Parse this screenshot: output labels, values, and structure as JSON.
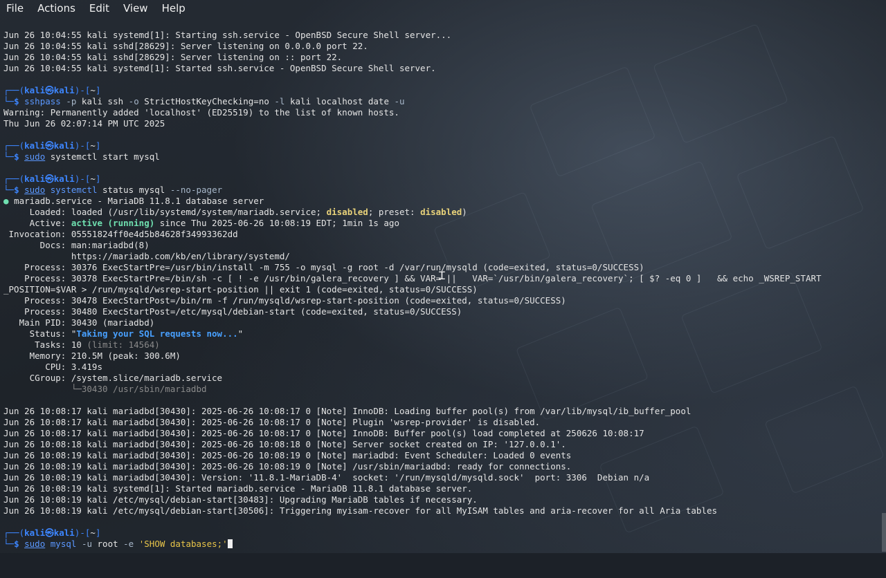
{
  "menu": [
    "File",
    "Actions",
    "Edit",
    "View",
    "Help"
  ],
  "prompt": {
    "user": "kali",
    "at": "㉿",
    "host": "kali",
    "dir": "~"
  },
  "lines": {
    "l1": "Jun 26 10:04:55 kali systemd[1]: Starting ssh.service - OpenBSD Secure Shell server...",
    "l2": "Jun 26 10:04:55 kali sshd[28629]: Server listening on 0.0.0.0 port 22.",
    "l3": "Jun 26 10:04:55 kali sshd[28629]: Server listening on :: port 22.",
    "l4": "Jun 26 10:04:55 kali systemd[1]: Started ssh.service - OpenBSD Secure Shell server.",
    "warn": "Warning: Permanently added 'localhost' (ED25519) to the list of known hosts.",
    "date": "Thu Jun 26 02:07:14 PM UTC 2025",
    "svc_head": "mariadb.service - MariaDB 11.8.1 database server",
    "loaded_a": "     Loaded: loaded (/usr/lib/systemd/system/mariadb.service; ",
    "loaded_b": "disabled",
    "loaded_c": "; preset: ",
    "loaded_d": "disabled",
    "loaded_e": ")",
    "active_a": "     Active: ",
    "active_b": "active (running)",
    "active_c": " since Thu 2025-06-26 10:08:19 EDT; 1min 1s ago",
    "invocation": " Invocation: 05551824ff0e4d5b84628f34993362dd",
    "docs1": "       Docs: man:mariadbd(8)",
    "docs2": "             https://mariadb.com/kb/en/library/systemd/",
    "proc1": "    Process: 30376 ExecStartPre=/usr/bin/install -m 755 -o mysql -g root -d /var/run/mysqld (code=exited, status=0/SUCCESS)",
    "proc2": "    Process: 30378 ExecStartPre=/bin/sh -c [ ! -e /usr/bin/galera_recovery ] && VAR= ||   VAR=`/usr/bin/galera_recovery`; [ $? -eq 0 ]   && echo _WSREP_START",
    "proc2b": "_POSITION=$VAR > /run/mysqld/wsrep-start-position || exit 1 (code=exited, status=0/SUCCESS)",
    "proc3": "    Process: 30478 ExecStartPost=/bin/rm -f /run/mysqld/wsrep-start-position (code=exited, status=0/SUCCESS)",
    "proc4": "    Process: 30480 ExecStartPost=/etc/mysql/debian-start (code=exited, status=0/SUCCESS)",
    "mainpid": "   Main PID: 30430 (mariadbd)",
    "status_a": "     Status: \"",
    "status_b": "Taking your SQL requests now...",
    "status_c": "\"",
    "tasks_a": "      Tasks: 10 ",
    "tasks_b": "(limit: 14564)",
    "memory": "     Memory: 210.5M (peak: 300.6M)",
    "cpu": "        CPU: 3.419s",
    "cgroup": "     CGroup: /system.slice/mariadb.service",
    "cgroup_child": "             └─30430 /usr/sbin/mariadbd",
    "j1": "Jun 26 10:08:17 kali mariadbd[30430]: 2025-06-26 10:08:17 0 [Note] InnoDB: Loading buffer pool(s) from /var/lib/mysql/ib_buffer_pool",
    "j2": "Jun 26 10:08:17 kali mariadbd[30430]: 2025-06-26 10:08:17 0 [Note] Plugin 'wsrep-provider' is disabled.",
    "j3": "Jun 26 10:08:17 kali mariadbd[30430]: 2025-06-26 10:08:17 0 [Note] InnoDB: Buffer pool(s) load completed at 250626 10:08:17",
    "j4": "Jun 26 10:08:18 kali mariadbd[30430]: 2025-06-26 10:08:18 0 [Note] Server socket created on IP: '127.0.0.1'.",
    "j5": "Jun 26 10:08:19 kali mariadbd[30430]: 2025-06-26 10:08:19 0 [Note] mariadbd: Event Scheduler: Loaded 0 events",
    "j6": "Jun 26 10:08:19 kali mariadbd[30430]: 2025-06-26 10:08:19 0 [Note] /usr/sbin/mariadbd: ready for connections.",
    "j7": "Jun 26 10:08:19 kali mariadbd[30430]: Version: '11.8.1-MariaDB-4'  socket: '/run/mysqld/mysqld.sock'  port: 3306  Debian n/a",
    "j8": "Jun 26 10:08:19 kali systemd[1]: Started mariadb.service - MariaDB 11.8.1 database server.",
    "j9": "Jun 26 10:08:19 kali /etc/mysql/debian-start[30483]: Upgrading MariaDB tables if necessary.",
    "j10": "Jun 26 10:08:19 kali /etc/mysql/debian-start[30506]: Triggering myisam-recover for all MyISAM tables and aria-recover for all Aria tables"
  },
  "commands": {
    "c1": {
      "bin": "sshpass",
      "rest_a": " ",
      "opt1": "-p",
      "rest_b": " kali ssh ",
      "opt2": "-o",
      "rest_c": " StrictHostKeyChecking=no ",
      "opt3": "-l",
      "rest_d": " kali localhost date ",
      "opt4": "-u"
    },
    "c2": {
      "sudo": "sudo",
      "rest": " systemctl start mysql",
      "bin": "systemctl"
    },
    "c3": {
      "sudo": "sudo",
      "bin": "systemctl",
      "rest": " status mysql ",
      "opt": "--no-pager"
    },
    "c4": {
      "sudo": "sudo",
      "bin": "mysql",
      "opt1": "-u",
      "rest": " root ",
      "opt2": "-e",
      "str": "'SHOW databases;'"
    }
  },
  "colors": {
    "prompt": "#3d86ff",
    "active": "#6fe0b0",
    "status": "#48a0ff",
    "disabled": "#e8d27a"
  }
}
